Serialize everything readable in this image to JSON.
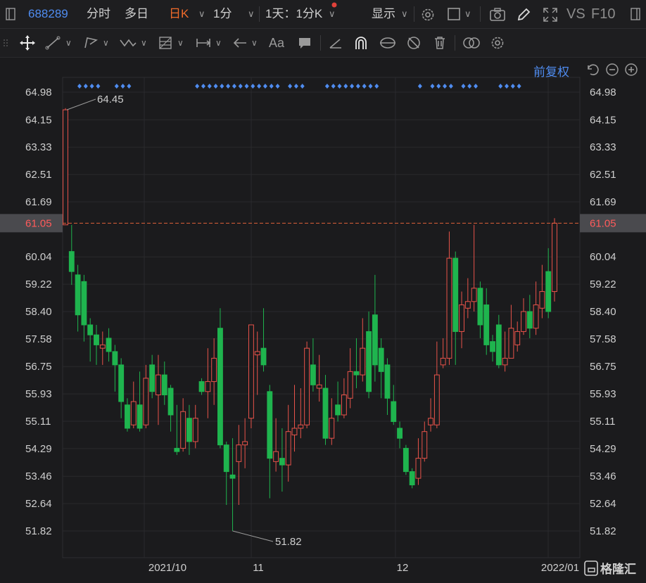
{
  "header": {
    "stock_code": "688289",
    "tabs": [
      "分时",
      "多日",
      "日K",
      "1分"
    ],
    "active_tab": "日K",
    "period_selector": "1天：1分K",
    "display_label": "显示",
    "vs_label": "VS",
    "f10_label": "F10"
  },
  "toolbar": {
    "tool_font_label": "Aa"
  },
  "chart_controls": {
    "restore_label": "前复权"
  },
  "colors": {
    "up": "#e8534a",
    "down": "#1fb44e",
    "current_price_line": "#e0613a",
    "marker": "#4f8cf0",
    "background": "#1b1b1d",
    "grid": "#2a2a2d"
  },
  "chart_data": {
    "type": "candlestick",
    "y_ticks": [
      "64.98",
      "64.15",
      "63.33",
      "62.51",
      "61.69",
      "61.05",
      "60.04",
      "59.22",
      "58.40",
      "57.58",
      "56.75",
      "55.93",
      "55.11",
      "54.29",
      "53.46",
      "52.64",
      "51.82"
    ],
    "ylim": [
      51.82,
      64.98
    ],
    "x_labels": [
      "2021/10",
      "11",
      "12",
      "2022/01"
    ],
    "current_price": "61.05",
    "high_annotation": "64.45",
    "low_annotation": "51.82",
    "candles": [
      [
        61.0,
        64.45,
        64.5,
        61.0
      ],
      [
        60.2,
        59.6,
        61.0,
        59.2
      ],
      [
        59.5,
        58.3,
        59.8,
        57.8
      ],
      [
        59.3,
        58.0,
        59.5,
        57.5
      ],
      [
        58.0,
        57.7,
        58.2,
        56.9
      ],
      [
        57.7,
        57.4,
        58.0,
        56.8
      ],
      [
        57.3,
        57.4,
        57.8,
        56.8
      ],
      [
        57.6,
        57.2,
        57.9,
        56.9
      ],
      [
        57.2,
        56.8,
        57.4,
        56.0
      ],
      [
        56.8,
        55.7,
        57.0,
        55.2
      ],
      [
        55.6,
        54.9,
        55.8,
        54.8
      ],
      [
        55.0,
        55.7,
        56.3,
        54.9
      ],
      [
        55.6,
        54.9,
        56.6,
        54.8
      ],
      [
        55.0,
        56.4,
        56.8,
        54.9
      ],
      [
        56.8,
        56.0,
        57.1,
        55.8
      ],
      [
        55.9,
        56.5,
        57.1,
        55.0
      ],
      [
        56.5,
        55.9,
        56.9,
        55.6
      ],
      [
        56.1,
        55.3,
        56.2,
        54.8
      ],
      [
        54.3,
        54.2,
        55.6,
        54.1
      ],
      [
        54.3,
        55.4,
        55.8,
        54.2
      ],
      [
        55.2,
        54.5,
        55.6,
        54.1
      ],
      [
        54.5,
        55.2,
        55.6,
        54.3
      ],
      [
        56.3,
        56.0,
        56.4,
        55.9
      ],
      [
        56.0,
        56.3,
        57.3,
        55.2
      ],
      [
        56.3,
        57.0,
        57.6,
        55.6
      ],
      [
        57.9,
        54.4,
        58.5,
        54.3
      ],
      [
        54.4,
        53.6,
        54.5,
        52.6
      ],
      [
        53.5,
        53.4,
        54.6,
        51.82
      ],
      [
        53.9,
        54.4,
        55.0,
        52.6
      ],
      [
        54.4,
        54.5,
        55.2,
        53.7
      ],
      [
        55.2,
        58.0,
        58.0,
        54.9
      ],
      [
        57.1,
        57.2,
        57.8,
        55.9
      ],
      [
        57.3,
        56.8,
        58.5,
        56.6
      ],
      [
        56.0,
        54.0,
        56.2,
        52.8
      ],
      [
        53.9,
        54.2,
        55.2,
        53.6
      ],
      [
        54.0,
        53.8,
        54.9,
        53.0
      ],
      [
        53.8,
        54.8,
        55.6,
        53.3
      ],
      [
        54.7,
        54.9,
        56.2,
        54.2
      ],
      [
        54.9,
        55.0,
        56.1,
        54.6
      ],
      [
        55.0,
        57.3,
        57.5,
        54.9
      ],
      [
        56.8,
        56.2,
        57.6,
        56.0
      ],
      [
        56.1,
        56.2,
        57.1,
        55.7
      ],
      [
        56.1,
        54.6,
        56.5,
        54.4
      ],
      [
        54.6,
        55.2,
        55.8,
        54.4
      ],
      [
        55.6,
        55.3,
        56.3,
        55.1
      ],
      [
        55.3,
        55.9,
        56.4,
        55.2
      ],
      [
        55.8,
        56.6,
        57.3,
        55.5
      ],
      [
        56.6,
        56.5,
        57.6,
        56.1
      ],
      [
        56.5,
        57.3,
        58.2,
        56.3
      ],
      [
        57.8,
        56.0,
        58.4,
        55.8
      ],
      [
        58.3,
        56.8,
        59.5,
        56.3
      ],
      [
        57.3,
        56.6,
        57.6,
        55.8
      ],
      [
        56.8,
        55.8,
        57.0,
        55.3
      ],
      [
        55.7,
        55.1,
        56.2,
        55.0
      ],
      [
        54.9,
        54.6,
        55.1,
        54.3
      ],
      [
        54.3,
        53.6,
        54.4,
        53.5
      ],
      [
        53.6,
        53.2,
        53.7,
        53.1
      ],
      [
        53.4,
        54.0,
        54.6,
        53.2
      ],
      [
        54.0,
        54.8,
        55.1,
        53.9
      ],
      [
        55.0,
        55.2,
        55.8,
        54.8
      ],
      [
        55.0,
        56.5,
        57.5,
        54.9
      ],
      [
        56.8,
        57.0,
        57.6,
        56.7
      ],
      [
        57.0,
        60.0,
        60.8,
        56.8
      ],
      [
        60.0,
        57.8,
        60.2,
        56.8
      ],
      [
        57.8,
        58.6,
        59.0,
        57.3
      ],
      [
        58.5,
        58.7,
        59.4,
        58.2
      ],
      [
        58.7,
        59.1,
        61.0,
        58.4
      ],
      [
        59.1,
        58.0,
        59.3,
        57.6
      ],
      [
        58.6,
        57.4,
        59.1,
        57.1
      ],
      [
        57.5,
        57.2,
        57.7,
        56.9
      ],
      [
        58.0,
        56.8,
        58.3,
        56.7
      ],
      [
        56.8,
        57.0,
        57.8,
        56.6
      ],
      [
        57.0,
        57.9,
        58.6,
        57.0
      ],
      [
        57.4,
        57.8,
        58.1,
        57.2
      ],
      [
        57.8,
        58.4,
        58.8,
        57.7
      ],
      [
        58.4,
        57.9,
        58.9,
        57.6
      ],
      [
        57.9,
        58.6,
        59.3,
        57.7
      ],
      [
        58.5,
        59.0,
        59.8,
        58.2
      ],
      [
        59.6,
        58.4,
        60.3,
        58.2
      ],
      [
        59.0,
        61.05,
        61.2,
        58.7
      ]
    ],
    "marker_groups": [
      [
        0,
        3
      ],
      [
        6,
        8
      ],
      [
        19,
        23
      ],
      [
        24,
        26
      ],
      [
        27,
        32
      ],
      [
        34,
        36
      ],
      [
        40,
        42
      ],
      [
        43,
        48
      ],
      [
        55,
        55
      ],
      [
        57,
        60
      ],
      [
        62,
        64
      ],
      [
        68,
        71
      ]
    ]
  }
}
